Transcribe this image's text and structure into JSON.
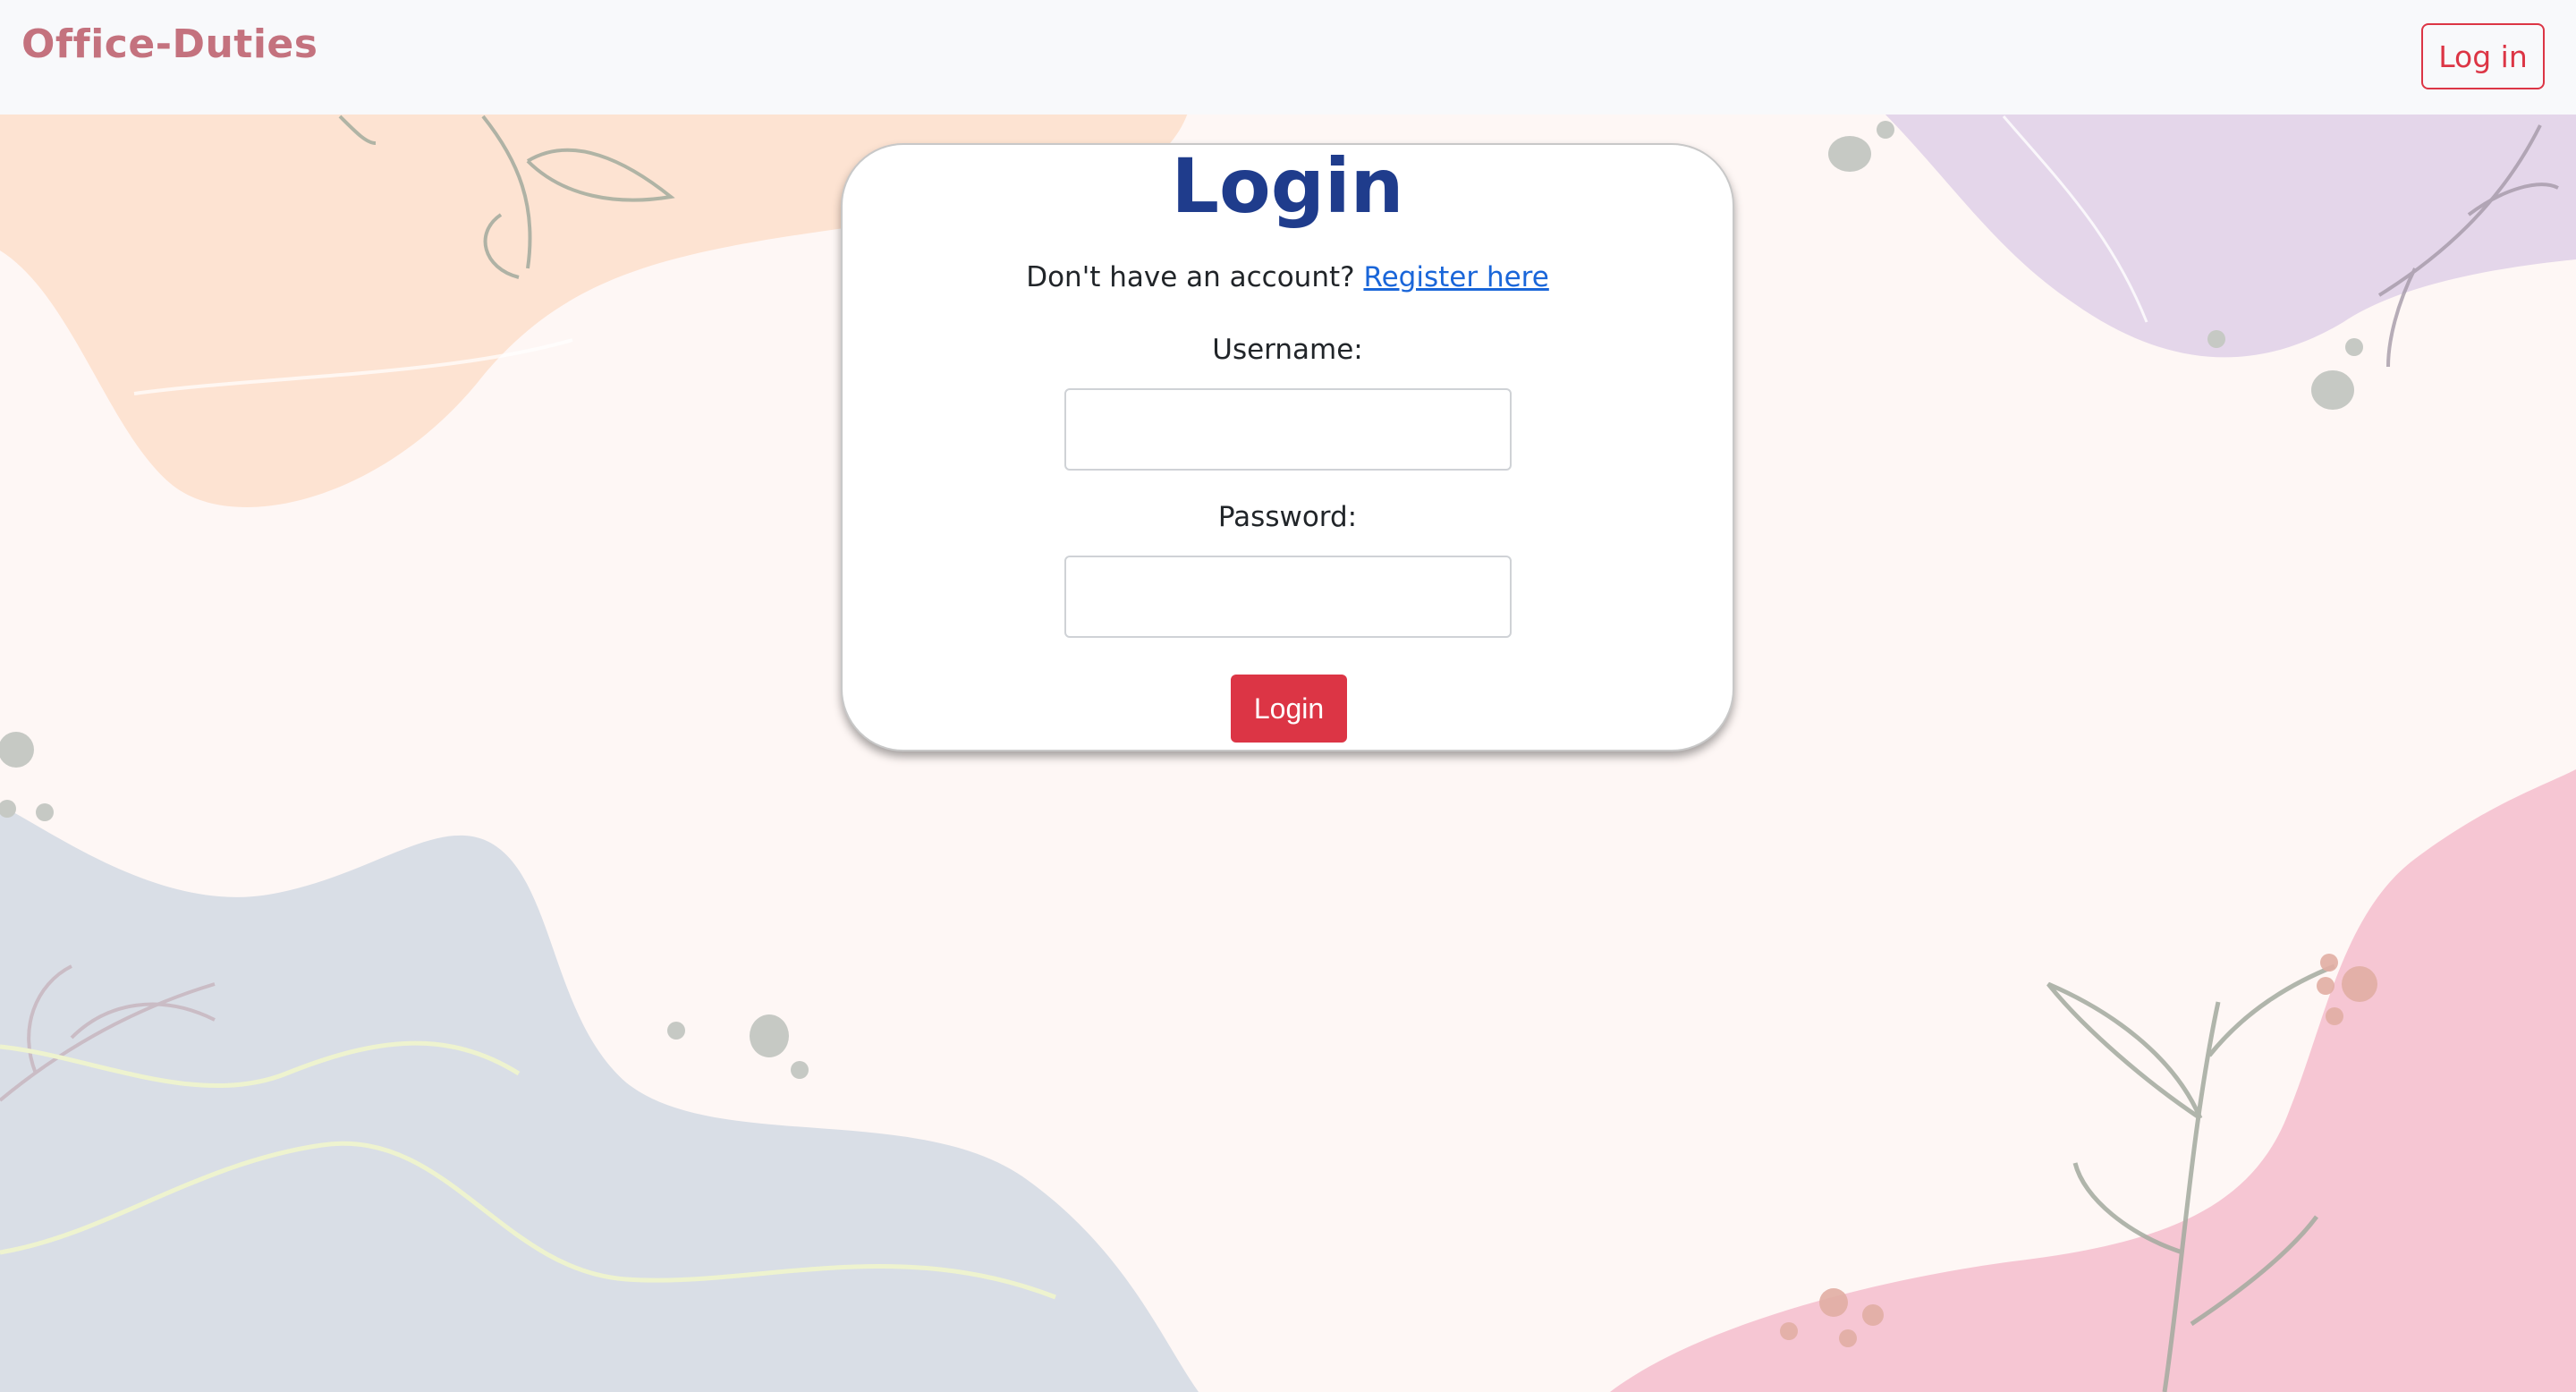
{
  "navbar": {
    "brand": "Office-Duties",
    "login_button": "Log in"
  },
  "login_card": {
    "title": "Login",
    "register_prompt": "Don't have an account?",
    "register_link": "Register here",
    "username_label": "Username:",
    "username_value": "",
    "password_label": "Password:",
    "password_value": "",
    "submit_button": "Login"
  },
  "colors": {
    "brand": "#c4727e",
    "title": "#1f3c8c",
    "danger": "#dc3545",
    "link": "#1a66d9"
  }
}
